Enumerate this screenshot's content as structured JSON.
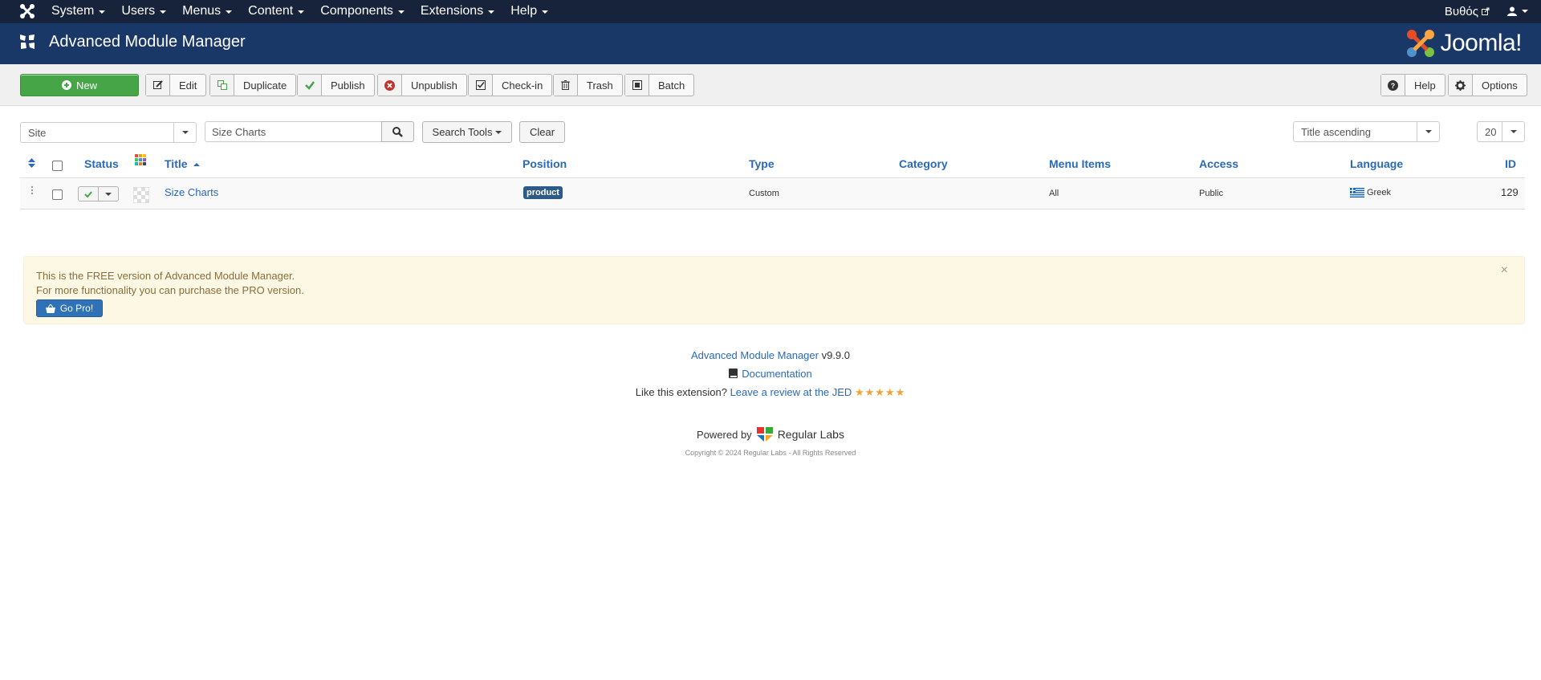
{
  "navbar": {
    "menu": [
      "System",
      "Users",
      "Menus",
      "Content",
      "Components",
      "Extensions",
      "Help"
    ],
    "site_link": "Βυθός"
  },
  "header": {
    "title": "Advanced Module Manager",
    "brand": "Joomla!"
  },
  "toolbar": {
    "new_label": "New",
    "edit_label": "Edit",
    "duplicate_label": "Duplicate",
    "publish_label": "Publish",
    "unpublish_label": "Unpublish",
    "checkin_label": "Check-in",
    "trash_label": "Trash",
    "batch_label": "Batch",
    "help_label": "Help",
    "options_label": "Options"
  },
  "filters": {
    "client": "Site",
    "search_value": "Size Charts",
    "search_tools_label": "Search Tools",
    "clear_label": "Clear",
    "ordering": "Title ascending",
    "limit": "20"
  },
  "table": {
    "headers": {
      "status": "Status",
      "title": "Title",
      "position": "Position",
      "type": "Type",
      "category": "Category",
      "menu_items": "Menu Items",
      "access": "Access",
      "language": "Language",
      "id": "ID"
    },
    "rows": [
      {
        "title": "Size Charts",
        "position": "product",
        "type": "Custom",
        "category": "",
        "menu_items": "All",
        "access": "Public",
        "language": "Greek",
        "id": "129"
      }
    ]
  },
  "alert": {
    "line1": "This is the FREE version of Advanced Module Manager.",
    "line2": "For more functionality you can purchase the PRO version.",
    "go_pro_label": "Go Pro!",
    "close": "×"
  },
  "footer": {
    "product_link": "Advanced Module Manager",
    "version": "v9.9.0",
    "documentation": "Documentation",
    "like_text": "Like this extension?",
    "review_link": "Leave a review at the JED",
    "stars": "★★★★★",
    "powered_by": "Powered by",
    "company": "Regular Labs",
    "copyright": "Copyright © 2024 Regular Labs - All Rights Reserved"
  },
  "colors": {
    "navbar_bg": "#17233b",
    "header_bg": "#1a3867",
    "new_button": "#46a546",
    "link": "#2a69b8",
    "alert_bg": "#fcf8e3",
    "position_badge": "#2d5a87"
  }
}
